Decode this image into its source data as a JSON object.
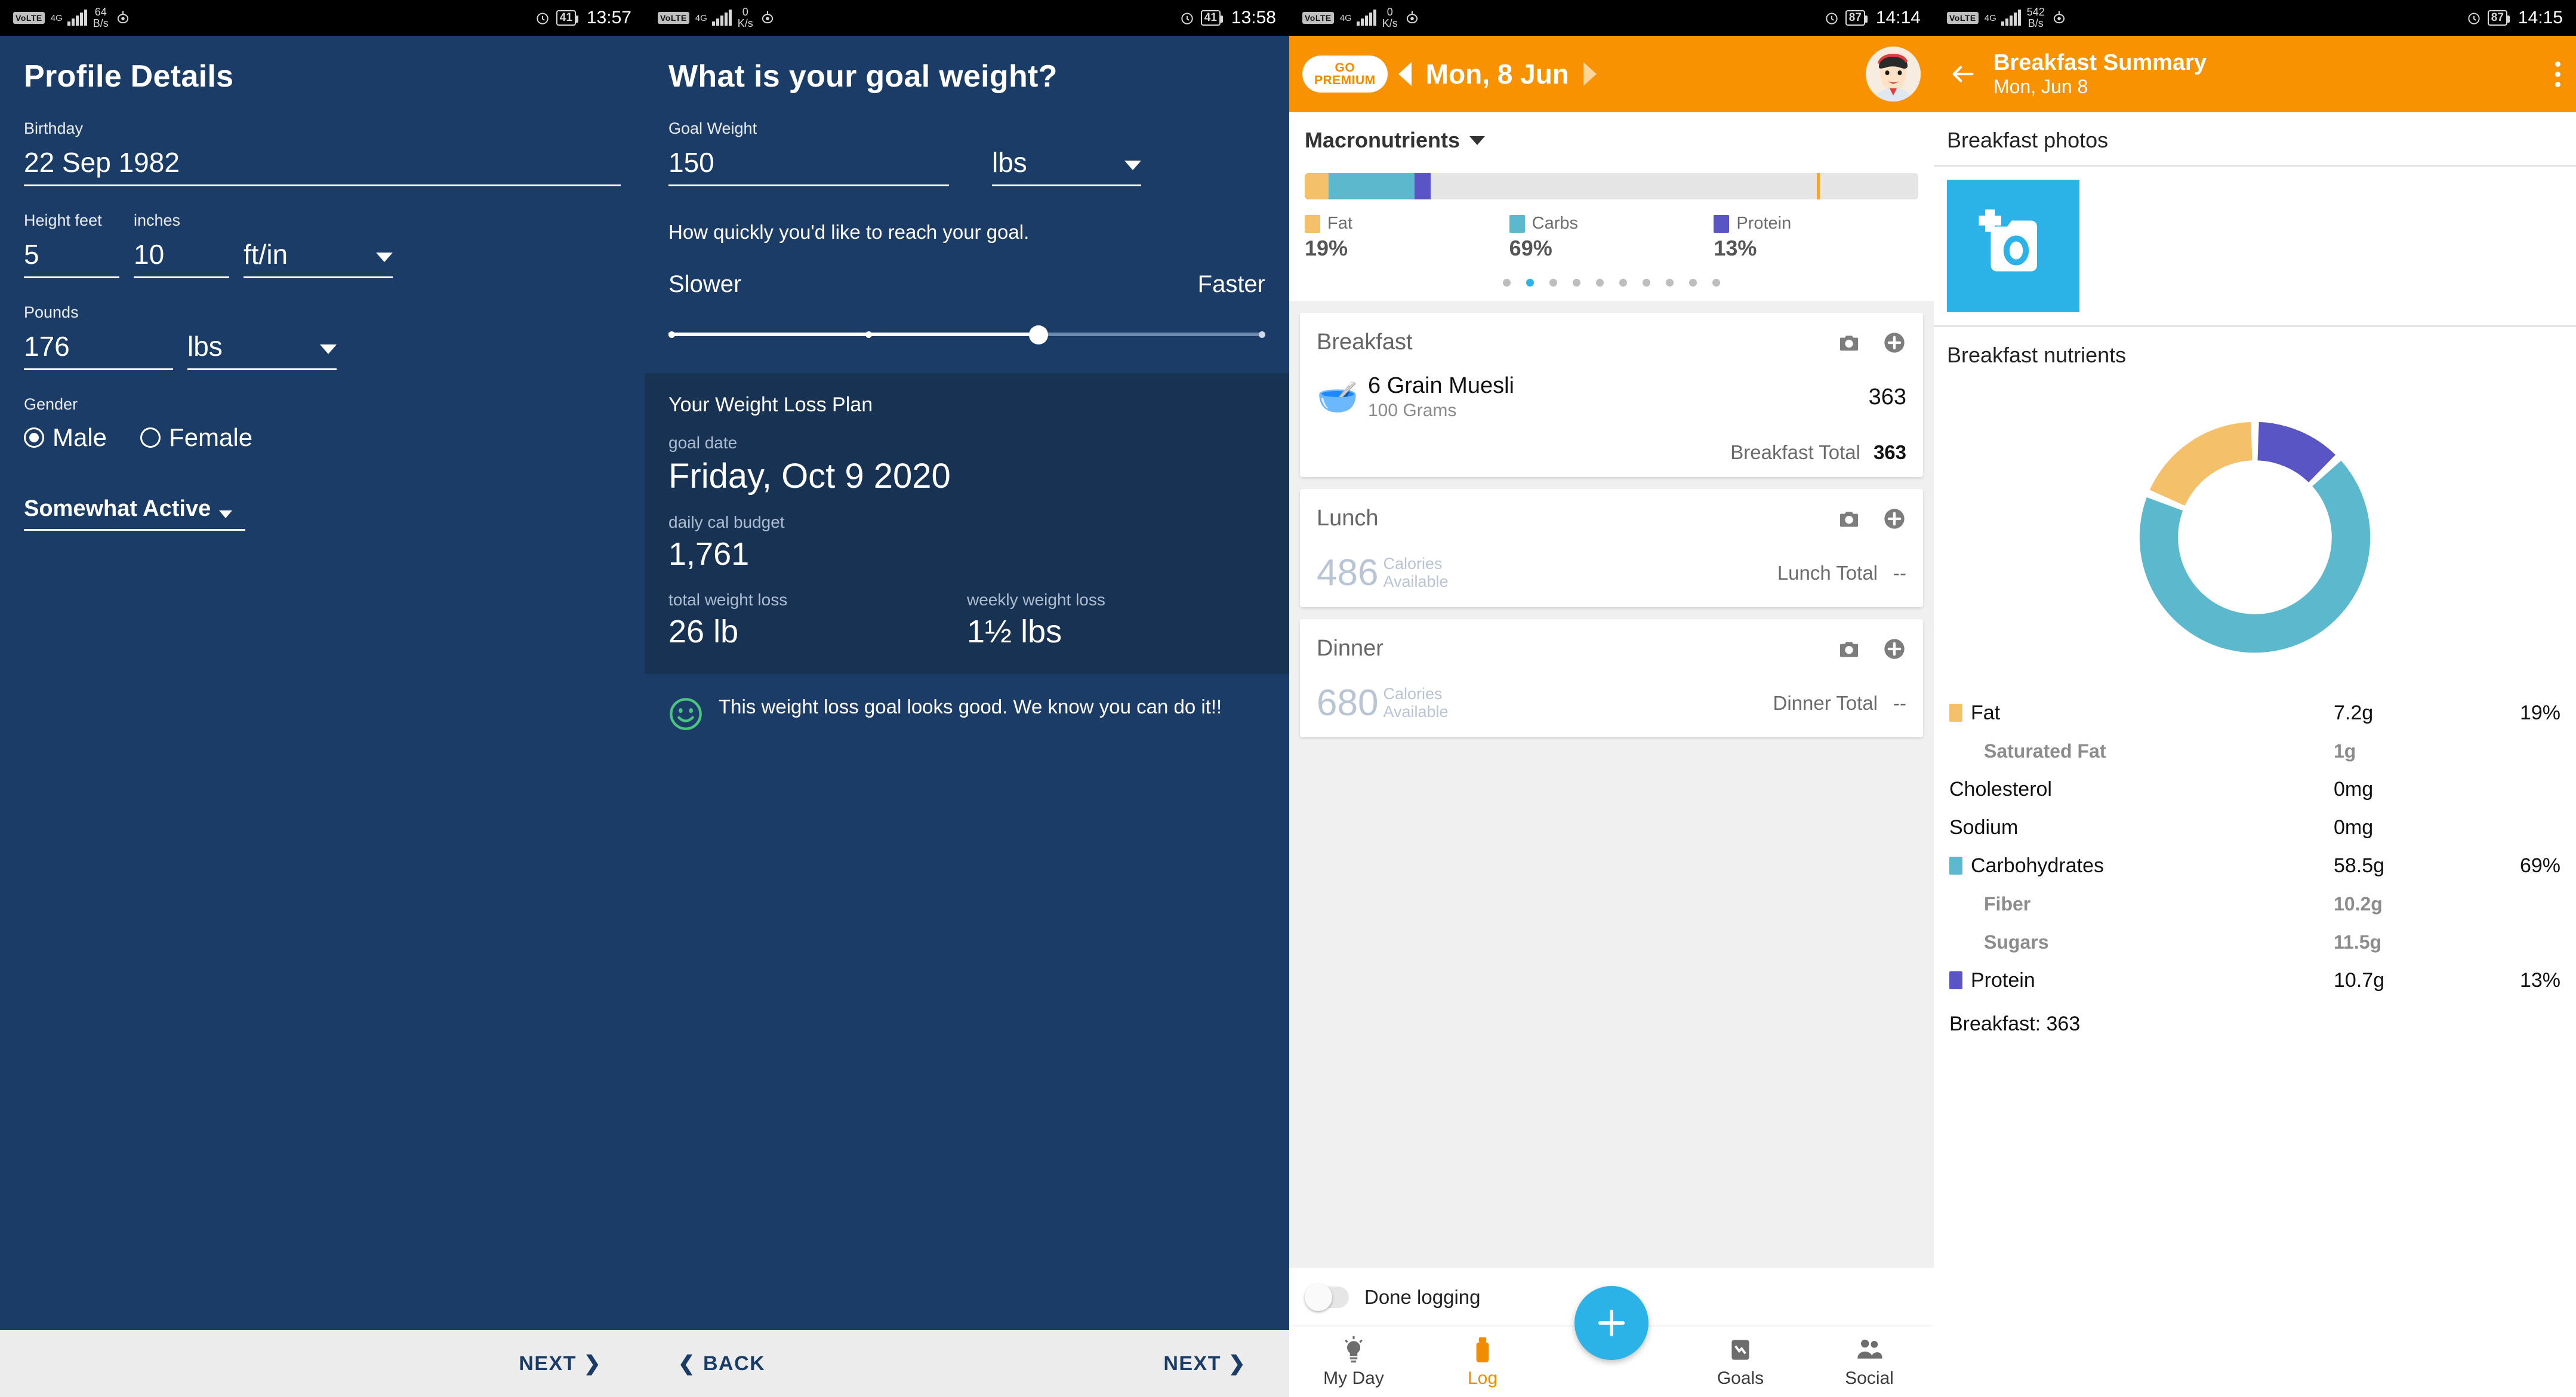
{
  "statusbars": [
    {
      "carrier": "VoLTE",
      "network": "4G",
      "speed": "64",
      "speed_unit": "B/s",
      "battery": "41",
      "time": "13:57"
    },
    {
      "carrier": "VoLTE",
      "network": "4G",
      "speed": "0",
      "speed_unit": "K/s",
      "battery": "41",
      "time": "13:58"
    },
    {
      "carrier": "VoLTE",
      "network": "4G",
      "speed": "0",
      "speed_unit": "K/s",
      "battery": "87",
      "time": "14:14"
    },
    {
      "carrier": "VoLTE",
      "network": "4G",
      "speed": "542",
      "speed_unit": "B/s",
      "battery": "87",
      "time": "14:15"
    }
  ],
  "profile": {
    "title": "Profile Details",
    "birthday_label": "Birthday",
    "birthday_value": "22 Sep 1982",
    "height_feet_label": "Height feet",
    "inches_label": "inches",
    "feet_value": "5",
    "inches_value": "10",
    "height_unit": "ft/in",
    "pounds_label": "Pounds",
    "pounds_value": "176",
    "weight_unit": "lbs",
    "gender_label": "Gender",
    "gender_male": "Male",
    "gender_female": "Female",
    "gender_selected": "Male",
    "activity_level": "Somewhat Active",
    "next_label": "NEXT"
  },
  "goal": {
    "title": "What is your goal weight?",
    "goal_weight_label": "Goal Weight",
    "goal_weight_value": "150",
    "goal_weight_unit": "lbs",
    "speed_prompt": "How quickly you'd like to reach your goal.",
    "slower_label": "Slower",
    "faster_label": "Faster",
    "plan_title": "Your Weight Loss Plan",
    "goal_date_label": "goal date",
    "goal_date_value": "Friday, Oct 9 2020",
    "daily_cal_label": "daily cal budget",
    "daily_cal_value": "1,761",
    "total_loss_label": "total weight loss",
    "total_loss_value": "26 lb",
    "weekly_loss_label": "weekly weight loss",
    "weekly_loss_value": "1½ lbs",
    "encouragement": "This weight loss goal looks good. We know you can do it!!",
    "back_label": "BACK",
    "next_label": "NEXT"
  },
  "log": {
    "go_premium_line1": "GO",
    "go_premium_line2": "PREMIUM",
    "date": "Mon, 8 Jun",
    "macro_header": "Macronutrients",
    "legend": [
      {
        "name": "Fat",
        "value": "19%",
        "color": "#f5c06a"
      },
      {
        "name": "Carbs",
        "value": "69%",
        "color": "#5bb8cd"
      },
      {
        "name": "Protein",
        "value": "13%",
        "color": "#5a55c4"
      }
    ],
    "page_dots": 10,
    "active_dot": 1,
    "meals": [
      {
        "name": "Breakfast",
        "items": [
          {
            "emoji": "🥣",
            "name": "6 Grain Muesli",
            "serving": "100 Grams",
            "calories": "363"
          }
        ],
        "total_label": "Breakfast Total",
        "total_value": "363"
      },
      {
        "name": "Lunch",
        "available": "486",
        "available_label_1": "Calories",
        "available_label_2": "Available",
        "total_label": "Lunch Total",
        "total_value": "--"
      },
      {
        "name": "Dinner",
        "available": "680",
        "available_label_1": "Calories",
        "available_label_2": "Available",
        "total_label": "Dinner Total",
        "total_value": "--"
      }
    ],
    "done_logging": "Done logging",
    "tabs": [
      {
        "label": "My Day",
        "active": false
      },
      {
        "label": "Log",
        "active": true
      },
      {
        "label": "Goals",
        "active": false
      },
      {
        "label": "Social",
        "active": false
      }
    ]
  },
  "summary": {
    "title": "Breakfast Summary",
    "subtitle": "Mon, Jun 8",
    "photos_title": "Breakfast photos",
    "nutrients_title": "Breakfast nutrients",
    "footer": "Breakfast: 363",
    "rows": [
      {
        "name": "Fat",
        "value": "7.2g",
        "pct": "19%",
        "color": "#f5c06a",
        "sub": false
      },
      {
        "name": "Saturated Fat",
        "value": "1g",
        "pct": "",
        "color": "",
        "sub": true
      },
      {
        "name": "Cholesterol",
        "value": "0mg",
        "pct": "",
        "color": "",
        "sub": false
      },
      {
        "name": "Sodium",
        "value": "0mg",
        "pct": "",
        "color": "",
        "sub": false
      },
      {
        "name": "Carbohydrates",
        "value": "58.5g",
        "pct": "69%",
        "color": "#5bb8cd",
        "sub": false
      },
      {
        "name": "Fiber",
        "value": "10.2g",
        "pct": "",
        "color": "",
        "sub": true
      },
      {
        "name": "Sugars",
        "value": "11.5g",
        "pct": "",
        "color": "",
        "sub": true
      },
      {
        "name": "Protein",
        "value": "10.7g",
        "pct": "13%",
        "color": "#5a55c4",
        "sub": false
      }
    ]
  },
  "chart_data": [
    {
      "type": "bar",
      "title": "Macronutrients",
      "orientation": "horizontal-stacked",
      "categories": [
        "Fat",
        "Carbs",
        "Protein"
      ],
      "values": [
        19,
        69,
        13
      ],
      "unit": "percent of logged calories",
      "colors": [
        "#f5c06a",
        "#5bb8cd",
        "#5a55c4"
      ],
      "track_color": "#e5e5e5",
      "fill_fraction_of_track": 0.205,
      "goal_marker_position": 0.835,
      "legend": "below-bar"
    },
    {
      "type": "pie",
      "title": "Breakfast nutrients",
      "subtype": "donut",
      "labels": [
        "Protein",
        "Carbs",
        "Fat"
      ],
      "values": [
        13,
        69,
        19
      ],
      "units": "%",
      "gram_values": [
        10.7,
        58.5,
        7.2
      ],
      "colors": [
        "#5a55c4",
        "#5bb8cd",
        "#f5c06a"
      ],
      "start_angle_deg": 0,
      "direction": "clockwise",
      "legend": "table-below"
    }
  ]
}
